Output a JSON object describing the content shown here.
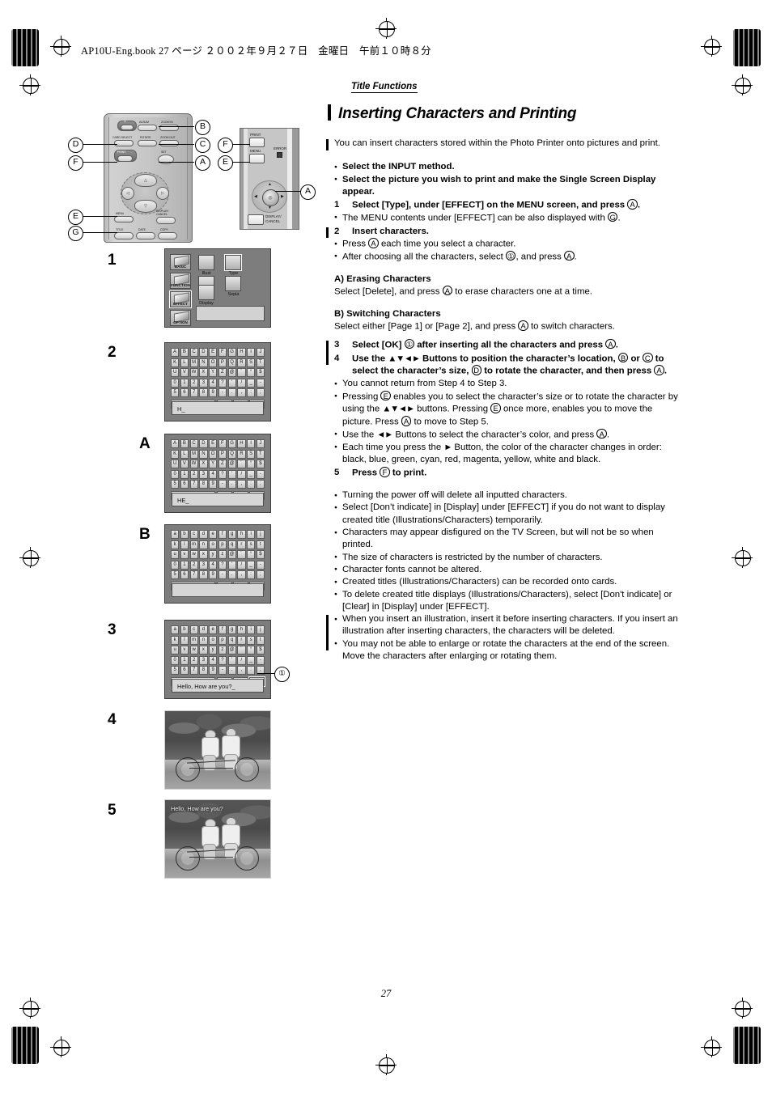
{
  "header": {
    "running_head": "AP10U-Eng.book   27 ページ   ２００２年９月２７日　金曜日　午前１０時８分"
  },
  "section": {
    "label": "Title Functions",
    "heading": "Inserting Characters and Printing"
  },
  "intro": "You can insert characters stored within the Photo Printer onto pictures and print.",
  "prereqs": [
    "Select the INPUT method.",
    "Select the picture you wish to print and make the Single Screen Display appear."
  ],
  "steps": {
    "s1_num": "1",
    "s1_text_a": "Select [Type], under [EFFECT] on the MENU screen, and press ",
    "s1_text_b": ".",
    "s1_note_a": "The MENU contents under [EFFECT] can be also displayed with ",
    "s1_note_b": ".",
    "s2_num": "2",
    "s2_text": "Insert characters.",
    "s2_note1_a": "Press ",
    "s2_note1_b": " each time you select a character.",
    "s2_note2_a": "After choosing all the characters, select ",
    "s2_note2_b": ", and press ",
    "s2_note2_c": ".",
    "s3_num": "3",
    "s3_text_a": "Select [OK] ",
    "s3_text_b": " after inserting all the characters and press ",
    "s3_text_c": ".",
    "s4_num": "4",
    "s4_text_a": "Use the ",
    "s4_arrows1": "▲▼◄►",
    "s4_text_b": " Buttons to position the character’s location, ",
    "s4_text_c": " or ",
    "s4_text_d": " to select the character’s size, ",
    "s4_text_e": " to rotate the character, and then press ",
    "s4_text_f": ".",
    "s4_note1": "You cannot return from Step 4 to Step 3.",
    "s4_note2_a": "Pressing ",
    "s4_note2_b": " enables you to select the character’s size or to rotate the character by using the ",
    "s4_note2_c": " buttons. Pressing ",
    "s4_note2_d": " once more, enables you to move the picture. Press ",
    "s4_note2_e": " to move to Step 5.",
    "s4_note3_a": "Use the ",
    "s4_arrows2": "◄►",
    "s4_note3_b": " Buttons to select the character’s color, and press ",
    "s4_note3_c": ".",
    "s4_note4_a": "Each time you press the ",
    "s4_arrow3": "►",
    "s4_note4_b": " Button, the color of the character changes in order: black, blue, green, cyan, red, magenta, yellow, white and black.",
    "s5_num": "5",
    "s5_text_a": "Press ",
    "s5_text_b": " to print."
  },
  "sub_sections": [
    {
      "heading": "A) Erasing Characters",
      "body_a": "Select [Delete], and press ",
      "body_b": " to erase characters one at a time."
    },
    {
      "heading": "B) Switching Characters",
      "body_a": "Select either [Page 1] or [Page 2], and press ",
      "body_b": " to switch characters."
    }
  ],
  "final_notes": [
    "Turning the power off will delete all inputted characters.",
    "Select [Don’t indicate] in [Display] under [EFFECT] if you do not want to display created title (Illustrations/Characters) temporarily.",
    "Characters may appear disfigured on the TV Screen, but will not be so when printed.",
    "The size of characters is restricted by the number of characters.",
    "Character fonts cannot be altered.",
    "Created titles (Illustrations/Characters) can be recorded onto cards.",
    "To delete created title displays (Illustrations/Characters), select [Don't indicate] or [Clear] in [Display] under [EFFECT].",
    "When you insert an illustration, insert it before inserting characters. If you insert an illustration after inserting characters, the characters will be deleted.",
    "You may not be able to enlarge or rotate the characters at the end of the screen. Move the characters after enlarging or rotating them."
  ],
  "callout_letters": {
    "A": "A",
    "B": "B",
    "C": "C",
    "D": "D",
    "E": "E",
    "F": "F",
    "G": "G",
    "one": "①"
  },
  "remote": {
    "buttons": [
      {
        "name": "power",
        "label": ""
      },
      {
        "name": "album",
        "label": "ALBUM"
      },
      {
        "name": "zoom-in",
        "label": "ZOOM IN"
      },
      {
        "name": "card-select",
        "label": "CARD SELECT"
      },
      {
        "name": "rotate",
        "label": "ROTATE"
      },
      {
        "name": "zoom-out",
        "label": "ZOOM OUT"
      },
      {
        "name": "print",
        "label": "PRINT"
      },
      {
        "name": "set",
        "label": "SET"
      },
      {
        "name": "menu",
        "label": "MENU"
      },
      {
        "name": "display-cancel",
        "label": "DISPLAY/\nCANCEL"
      },
      {
        "name": "title",
        "label": "TITLE"
      },
      {
        "name": "date",
        "label": "DATE"
      },
      {
        "name": "copy",
        "label": "COPY"
      }
    ],
    "labels": {
      "album": "ALBUM",
      "zoom_in": "ZOOM IN",
      "card_select": "CARD SELECT",
      "rotate": "ROTATE",
      "zoom_out": "ZOOM OUT",
      "print": "PRINT",
      "set": "SET",
      "menu": "MENU",
      "display_cancel_1": "DISPLAY/",
      "display_cancel_2": "CANCEL",
      "title": "TITLE",
      "date": "DATE",
      "copy": "COPY"
    }
  },
  "printer_panel": {
    "print": "PRINT",
    "menu": "MENU",
    "error": "ERROR",
    "display_cancel_1": "DISPLAY/",
    "display_cancel_2": "CANCEL"
  },
  "step_marks": {
    "m1": "1",
    "m2": "2",
    "mA": "A",
    "mB": "B",
    "m3": "3",
    "m4": "4",
    "m5": "5"
  },
  "menu_screen": {
    "tabs": [
      "BASIC",
      "FUNCTION",
      "EFFECT",
      "OPTION"
    ],
    "active_tab": "EFFECT",
    "icons": [
      "Illust",
      "Type",
      "Stamp",
      "Sepia"
    ],
    "icons_row2": [
      "Display"
    ],
    "selected_icon": "Type"
  },
  "keyboard_page1": {
    "page_label": "Page 1",
    "rows": [
      [
        "A",
        "B",
        "C",
        "D",
        "E",
        "F",
        "G",
        "H",
        "I",
        "J"
      ],
      [
        "K",
        "L",
        "M",
        "N",
        "O",
        "P",
        "Q",
        "R",
        "S",
        "T"
      ],
      [
        "U",
        "V",
        "W",
        "X",
        "Y",
        "Z",
        "@",
        "¨",
        "°",
        "$"
      ],
      [
        "0",
        "1",
        "2",
        "3",
        "4",
        "?",
        "'",
        "/",
        "_",
        "-"
      ],
      [
        "5",
        "6",
        "7",
        "8",
        "9",
        "-",
        ".",
        ",",
        ":",
        ";"
      ]
    ],
    "fn_keys": [
      "Page 1",
      "Delete",
      "Space",
      "OK"
    ]
  },
  "keyboard_page2": {
    "page_label": "Page 2",
    "rows": [
      [
        "a",
        "b",
        "c",
        "d",
        "e",
        "f",
        "g",
        "h",
        "i",
        "j"
      ],
      [
        "k",
        "l",
        "m",
        "n",
        "o",
        "p",
        "q",
        "r",
        "s",
        "t"
      ],
      [
        "u",
        "v",
        "w",
        "x",
        "y",
        "z",
        "@",
        "¨",
        "°",
        "$"
      ],
      [
        "0",
        "1",
        "2",
        "3",
        "4",
        "?",
        "'",
        "/",
        "_",
        "-"
      ],
      [
        "5",
        "6",
        "7",
        "8",
        "9",
        "-",
        ".",
        ",",
        ":",
        ";"
      ]
    ],
    "fn_keys": [
      "Page 2",
      "Delete",
      "Space",
      "OK"
    ]
  },
  "screens": {
    "screen2_text": "H_",
    "screenA_text": "HE_",
    "screenB_text": "",
    "screen3_text": "Hello, How are you?_",
    "photo_caption": "Hello, How are you?"
  },
  "footer": {
    "page_number": "27"
  }
}
